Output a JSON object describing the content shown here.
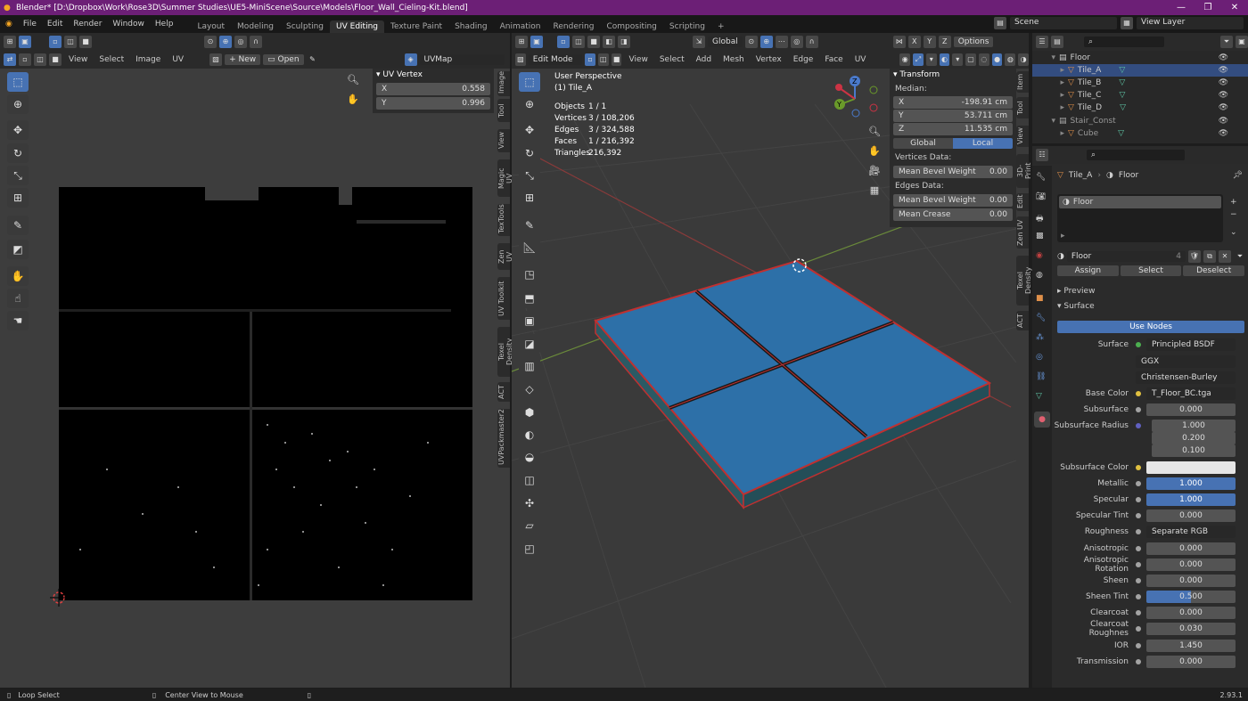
{
  "window": {
    "title": "Blender* [D:\\Dropbox\\Work\\Rose3D\\Summer Studies\\UE5-MiniScene\\Source\\Models\\Floor_Wall_Cieling-Kit.blend]",
    "min": "—",
    "max": "❐",
    "close": "✕"
  },
  "menu": [
    "File",
    "Edit",
    "Render",
    "Window",
    "Help"
  ],
  "workspaces": [
    "Layout",
    "Modeling",
    "Sculpting",
    "UV Editing",
    "Texture Paint",
    "Shading",
    "Animation",
    "Rendering",
    "Compositing",
    "Scripting"
  ],
  "active_workspace": "UV Editing",
  "scene": "Scene",
  "view_layer": "View Layer",
  "uv_header": {
    "view": "View",
    "select": "Select",
    "image": "Image",
    "uv": "UV",
    "new": "New",
    "open": "Open",
    "uvmap": "UVMap"
  },
  "uv_vertex": {
    "title": "UV Vertex",
    "x_label": "X",
    "x_value": "0.558",
    "y_label": "Y",
    "y_value": "0.996"
  },
  "uv_tabs": [
    "Image",
    "Tool",
    "View",
    "Magic UV",
    "TexTools",
    "Zen UV",
    "UV Toolkit",
    "Texel Density",
    "ACT",
    "UVPackmaster2"
  ],
  "vp_header": {
    "mode": "Edit Mode",
    "view": "View",
    "select": "Select",
    "add": "Add",
    "mesh": "Mesh",
    "vertex": "Vertex",
    "edge": "Edge",
    "face": "Face",
    "uv": "UV",
    "orientation": "Global",
    "options": "Options",
    "x": "X",
    "y": "Y",
    "z": "Z"
  },
  "viewport_info": {
    "perspective": "User Perspective",
    "object": "(1) Tile_A",
    "rows": [
      [
        "Objects",
        "1 / 1"
      ],
      [
        "Vertices",
        "3 / 108,206"
      ],
      [
        "Edges",
        "3 / 324,588"
      ],
      [
        "Faces",
        "1 / 216,392"
      ],
      [
        "Triangles",
        "216,392"
      ]
    ]
  },
  "transform": {
    "title": "Transform",
    "median": "Median:",
    "x": "-198.91 cm",
    "y": "53.711 cm",
    "z": "11.535 cm",
    "global": "Global",
    "local": "Local",
    "vertices_data": "Vertices Data:",
    "v_bevel": "Mean Bevel Weight",
    "v_bevel_val": "0.00",
    "edges_data": "Edges Data:",
    "e_bevel": "Mean Bevel Weight",
    "e_bevel_val": "0.00",
    "crease": "Mean Crease",
    "crease_val": "0.00"
  },
  "vp_tabs": [
    "Item",
    "Tool",
    "View",
    "3D-Print",
    "Edit",
    "Zen UV",
    "Texel Density",
    "ACT"
  ],
  "outliner": [
    {
      "name": "Floor",
      "indent": 0
    },
    {
      "name": "Tile_A",
      "indent": 1,
      "selected": true
    },
    {
      "name": "Tile_B",
      "indent": 1
    },
    {
      "name": "Tile_C",
      "indent": 1
    },
    {
      "name": "Tile_D",
      "indent": 1
    },
    {
      "name": "Stair_Const",
      "indent": 0
    },
    {
      "name": "Cube",
      "indent": 1
    }
  ],
  "props": {
    "object": "Tile_A",
    "material": "Floor",
    "slot": "Floor",
    "mat_name": "Floor",
    "users": "4",
    "assign": "Assign",
    "select": "Select",
    "deselect": "Deselect",
    "preview": "Preview",
    "surface_section": "Surface",
    "use_nodes": "Use Nodes"
  },
  "surface_rows": [
    {
      "label": "Surface",
      "value": "Principled BSDF",
      "style": "dark"
    },
    {
      "label": "",
      "value": "GGX",
      "style": "dark"
    },
    {
      "label": "",
      "value": "Christensen-Burley",
      "style": "dark"
    },
    {
      "label": "Base Color",
      "value": "T_Floor_BC.tga",
      "style": "dark"
    },
    {
      "label": "Subsurface",
      "value": "0.000",
      "style": ""
    },
    {
      "label": "Subsurface Radius",
      "value": "1.000",
      "style": ""
    },
    {
      "label": "",
      "value": "0.200",
      "style": ""
    },
    {
      "label": "",
      "value": "0.100",
      "style": ""
    },
    {
      "label": "Subsurface Color",
      "value": "",
      "style": "white"
    },
    {
      "label": "Metallic",
      "value": "1.000",
      "style": "blue"
    },
    {
      "label": "Specular",
      "value": "1.000",
      "style": "blue"
    },
    {
      "label": "Specular Tint",
      "value": "0.000",
      "style": ""
    },
    {
      "label": "Roughness",
      "value": "Separate RGB",
      "style": "dark"
    },
    {
      "label": "Anisotropic",
      "value": "0.000",
      "style": ""
    },
    {
      "label": "Anisotropic Rotation",
      "value": "0.000",
      "style": ""
    },
    {
      "label": "Sheen",
      "value": "0.000",
      "style": ""
    },
    {
      "label": "Sheen Tint",
      "value": "0.500",
      "style": "blue"
    },
    {
      "label": "Clearcoat",
      "value": "0.000",
      "style": ""
    },
    {
      "label": "Clearcoat Roughnes",
      "value": "0.030",
      "style": ""
    },
    {
      "label": "IOR",
      "value": "1.450",
      "style": ""
    },
    {
      "label": "Transmission",
      "value": "0.000",
      "style": ""
    }
  ],
  "status": {
    "left": "Loop Select",
    "center": "Center View to Mouse",
    "version": "2.93.1"
  }
}
